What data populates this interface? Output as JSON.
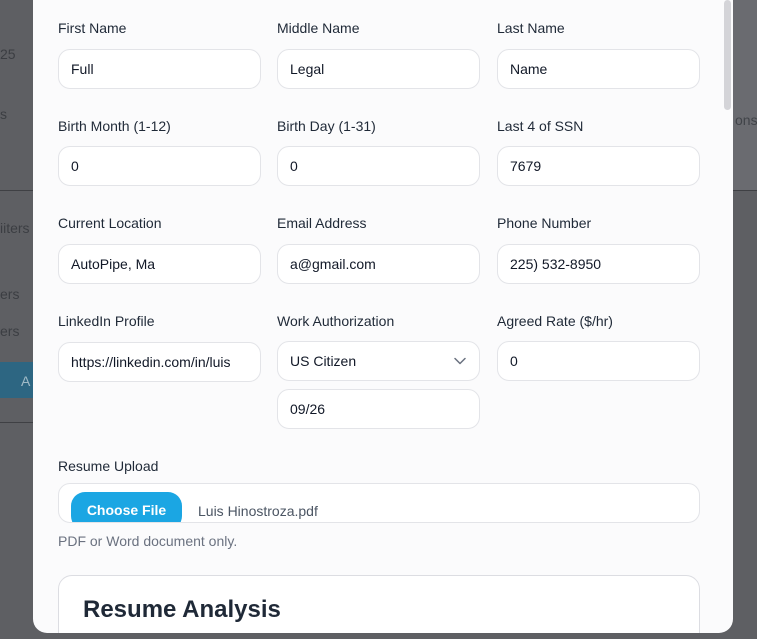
{
  "background": {
    "fragments": [
      "25",
      "s",
      "iiters",
      "ers",
      "ers",
      "A",
      "ons"
    ]
  },
  "form": {
    "first_name": {
      "label": "First Name",
      "value": "Full"
    },
    "middle_name": {
      "label": "Middle Name",
      "value": "Legal"
    },
    "last_name": {
      "label": "Last Name",
      "value": "Name"
    },
    "birth_month": {
      "label": "Birth Month (1-12)",
      "value": "0"
    },
    "birth_day": {
      "label": "Birth Day (1-31)",
      "value": "0"
    },
    "ssn_last4": {
      "label": "Last 4 of SSN",
      "value": "7679"
    },
    "location": {
      "label": "Current Location",
      "value": "AutoPipe, Ma"
    },
    "email": {
      "label": "Email Address",
      "value": "a@gmail.com"
    },
    "phone": {
      "label": "Phone Number",
      "value": "225) 532-8950"
    },
    "linkedin": {
      "label": "LinkedIn Profile",
      "value": "https://linkedin.com/in/luis"
    },
    "work_auth": {
      "label": "Work Authorization",
      "selected": "US Citizen",
      "extra_value": "09/26"
    },
    "rate": {
      "label": "Agreed Rate ($/hr)",
      "value": "0"
    }
  },
  "resume": {
    "label": "Resume Upload",
    "button_label": "Choose File",
    "file_name": "Luis Hinostroza.pdf",
    "hint": "PDF or Word document only."
  },
  "analysis": {
    "title": "Resume Analysis"
  },
  "colors": {
    "accent": "#1ba6e3",
    "overlay": "#5e5f63"
  },
  "icons": {
    "select_chevron": "chevron-down-icon"
  }
}
